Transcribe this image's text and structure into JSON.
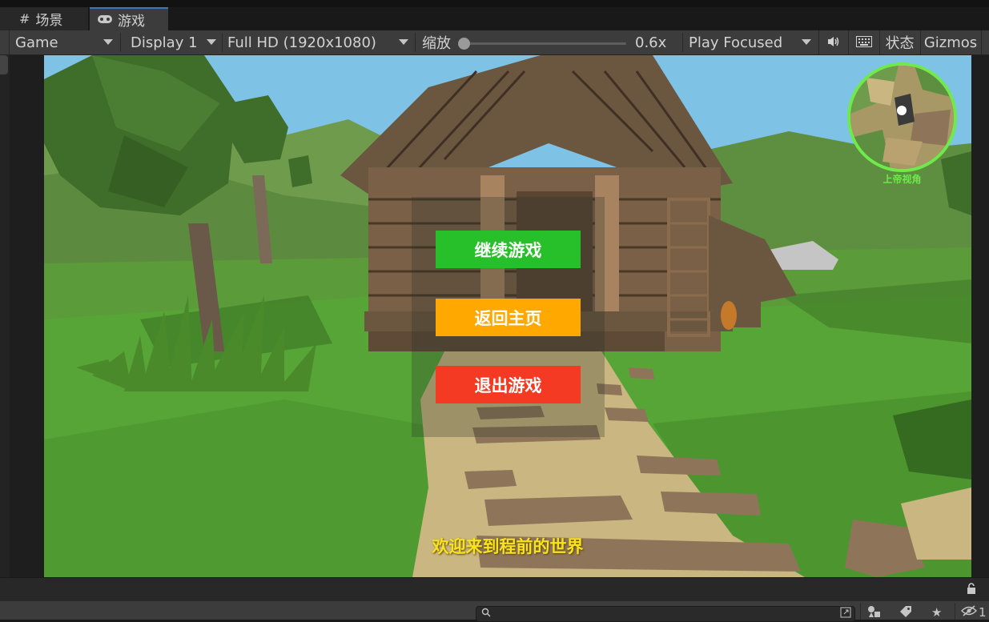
{
  "tabs": [
    {
      "label": "场景",
      "icon": "hash-icon"
    },
    {
      "label": "游戏",
      "icon": "gamepad-icon"
    }
  ],
  "toolbar": {
    "game_select": "Game",
    "display_select": "Display 1",
    "resolution_select": "Full HD (1920x1080)",
    "scale_label": "缩放",
    "scale_value": "0.6x",
    "scale_fraction": 0.0,
    "play_mode": "Play Focused",
    "stats_label": "状态",
    "gizmos_label": "Gizmos"
  },
  "game": {
    "menu": {
      "continue": "继续游戏",
      "home": "返回主页",
      "quit": "退出游戏"
    },
    "welcome": "欢迎来到程前的世界",
    "minimap_label": "上帝视角"
  },
  "colors": {
    "continue_button": "#27c02a",
    "home_button": "#fea800",
    "quit_button": "#f43a22",
    "welcome_text": "#f9e31e",
    "minimap_ring": "#6eea4a",
    "editor_bg": "#3c3c3c"
  },
  "bottom": {
    "visibility_count": "1"
  }
}
